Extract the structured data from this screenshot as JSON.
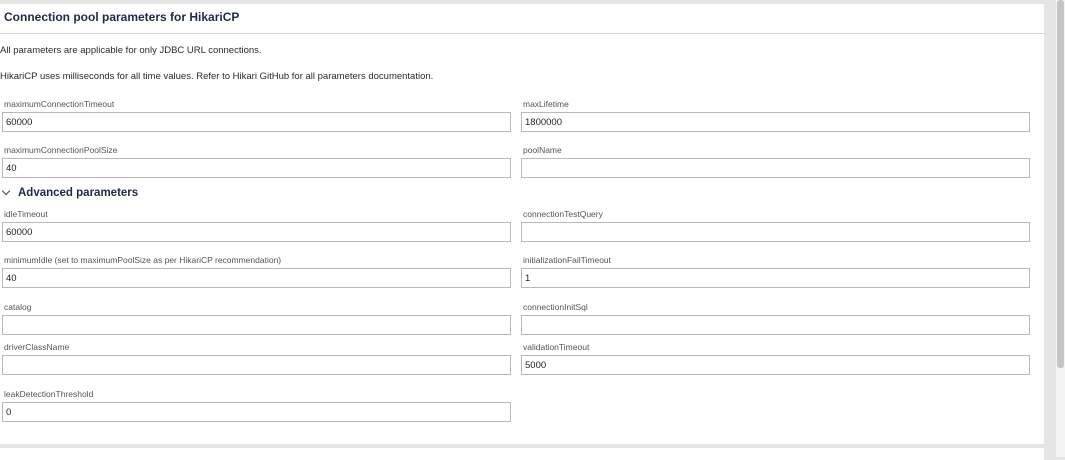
{
  "panel": {
    "title": "Connection pool parameters for HikariCP",
    "notes": [
      "All parameters are applicable for only JDBC URL connections.",
      "HikariCP uses milliseconds for all time values. Refer to Hikari GitHub for all parameters documentation."
    ]
  },
  "basic": {
    "maximumConnectionTimeout": {
      "label": "maximumConnectionTimeout",
      "value": "60000"
    },
    "maxLifetime": {
      "label": "maxLifetime",
      "value": "1800000"
    },
    "maximumConnectionPoolSize": {
      "label": "maximumConnectionPoolSize",
      "value": "40"
    },
    "poolName": {
      "label": "poolName",
      "value": ""
    }
  },
  "advanced": {
    "section_label": "Advanced parameters",
    "expanded": true,
    "idleTimeout": {
      "label": "idleTimeout",
      "value": "60000"
    },
    "connectionTestQuery": {
      "label": "connectionTestQuery",
      "value": ""
    },
    "minimumIdle": {
      "label": "minimumIdle (set to maximumPoolSize as per HikariCP recommendation)",
      "value": "40"
    },
    "initializationFailTimeout": {
      "label": "initializationFailTimeout",
      "value": "1"
    },
    "catalog": {
      "label": "catalog",
      "value": ""
    },
    "connectionInitSql": {
      "label": "connectionInitSql",
      "value": ""
    },
    "driverClassName": {
      "label": "driverClassName",
      "value": ""
    },
    "validationTimeout": {
      "label": "validationTimeout",
      "value": "5000"
    },
    "leakDetectionThreshold": {
      "label": "leakDetectionThreshold",
      "value": "0"
    }
  },
  "icons": {
    "section_toggle": "chevron-down-icon"
  }
}
